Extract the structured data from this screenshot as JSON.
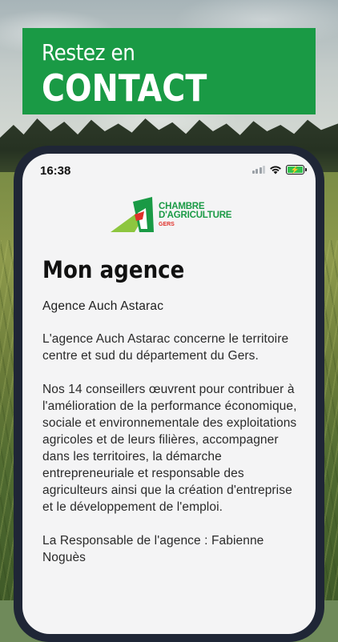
{
  "banner": {
    "line1": "Restez en",
    "line2": "CONTACT"
  },
  "status_bar": {
    "time": "16:38"
  },
  "logo": {
    "line1": "CHAMBRE",
    "line2": "D'AGRICULTURE",
    "line3": "GERS"
  },
  "page": {
    "title": "Mon agence",
    "agency_name": "Agence Auch Astarac",
    "paragraphs": [
      "L'agence Auch Astarac concerne le territoire centre et sud du département du Gers.",
      "Nos 14 conseillers œuvrent pour contribuer à l'amélioration de la performance économique, sociale et environnementale des exploitations agricoles et de leurs filières, accompagner dans les territoires, la démarche entrepreneuriale et responsable des agriculteurs ainsi que la création d'entreprise et le développement de l'emploi.",
      "La Responsable de l'agence : Fabienne Noguès"
    ]
  },
  "colors": {
    "brand_green": "#1a9a45",
    "brand_lime": "#8dc63f",
    "brand_red": "#e0302a",
    "phone_frame": "#1f2636"
  },
  "icons": [
    "signal-icon",
    "wifi-icon",
    "battery-charging-icon"
  ]
}
